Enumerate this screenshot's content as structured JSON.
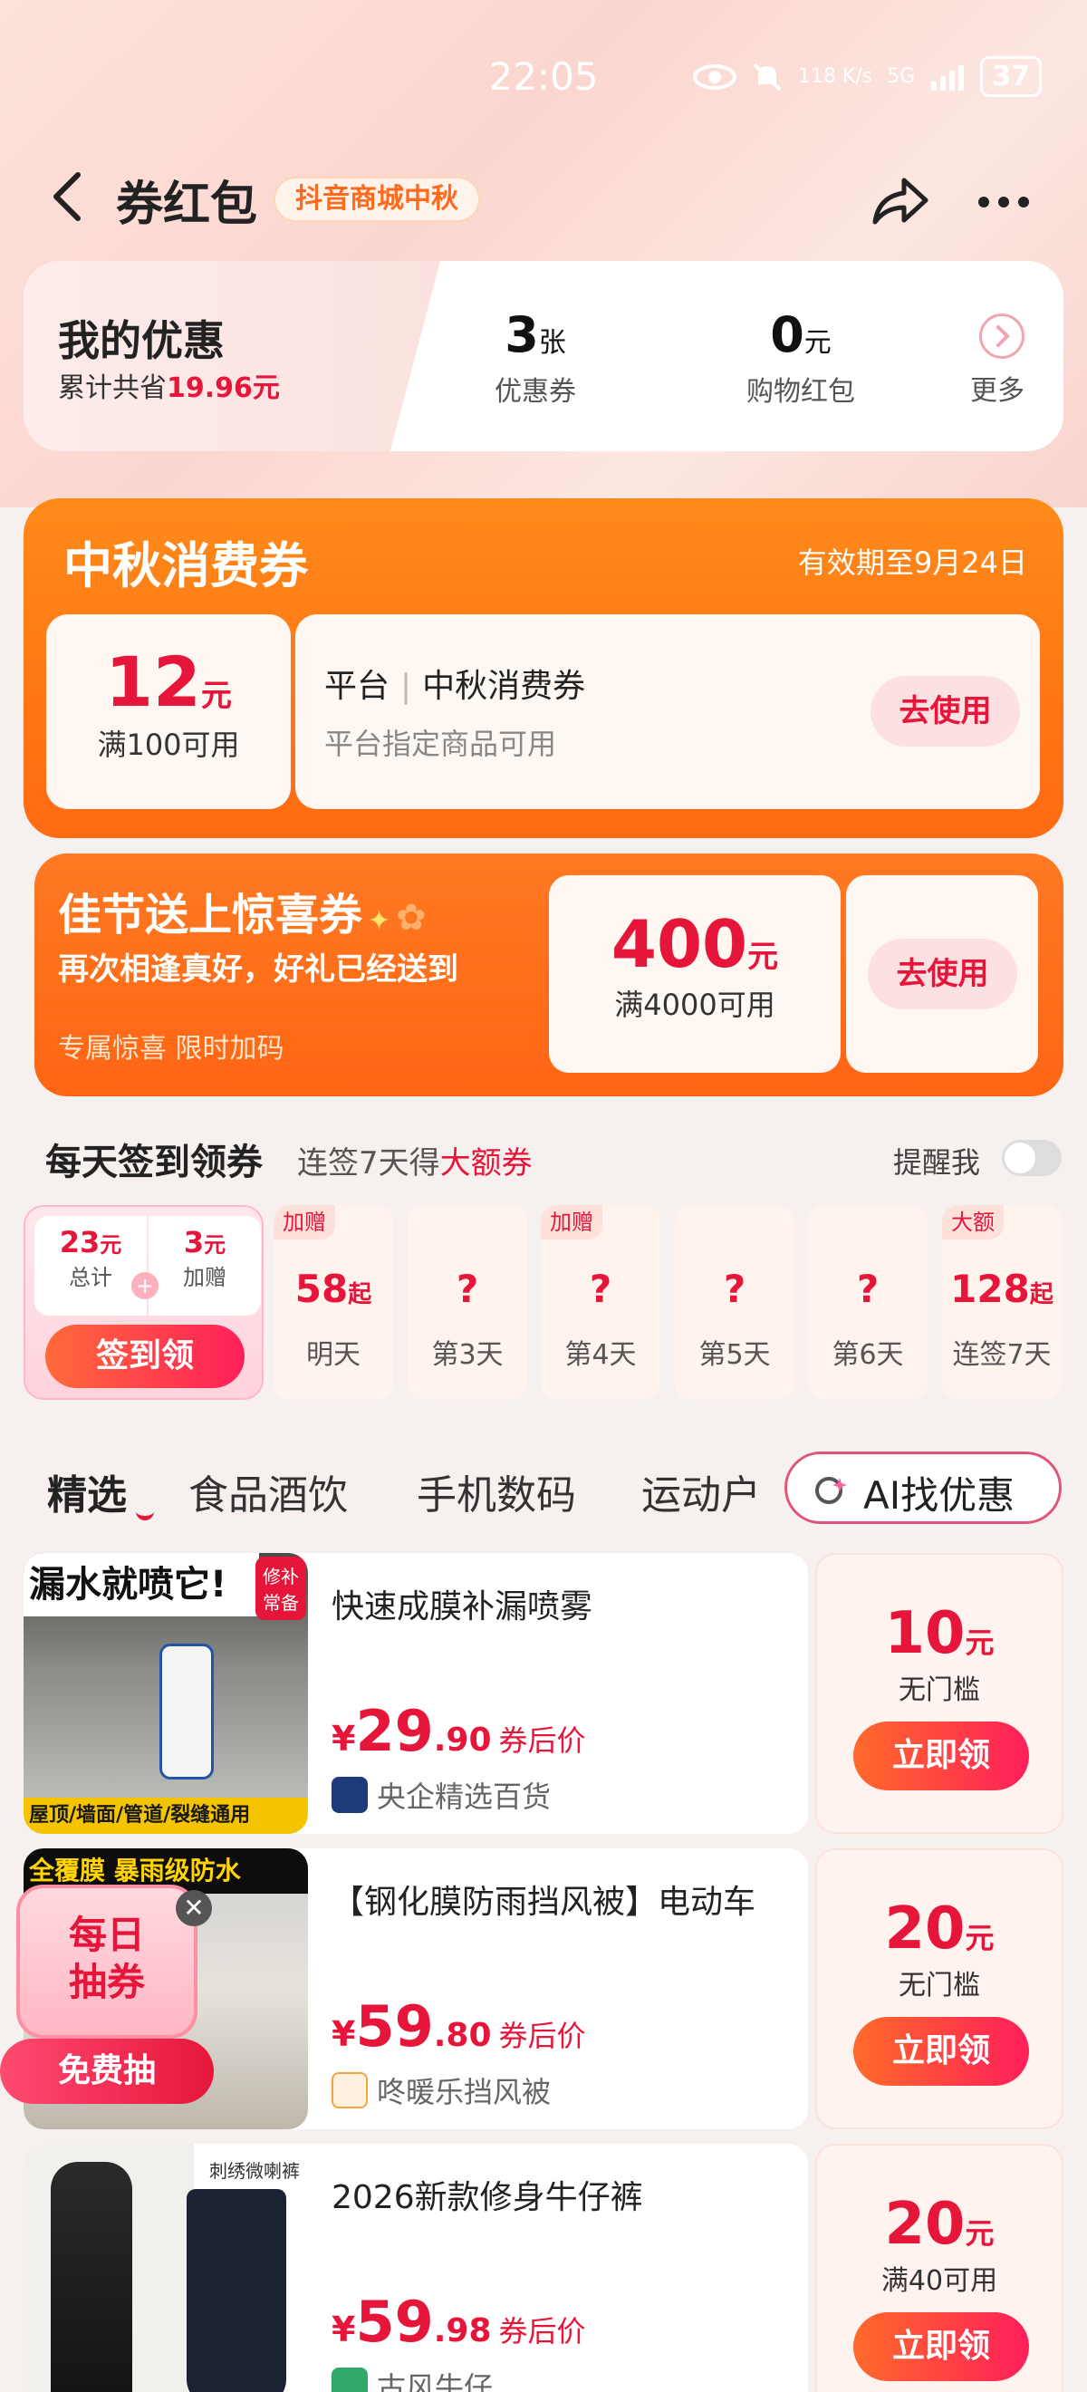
{
  "status_bar": {
    "time": "22:05",
    "network_speed": "118 K/s",
    "network_type": "5G",
    "battery": "37"
  },
  "header": {
    "title": "券红包",
    "event_badge": "抖音商城中秋"
  },
  "my_discount": {
    "title": "我的优惠",
    "saved_prefix": "累计共省",
    "saved_amount": "19.96元",
    "coupons_count": "3",
    "coupons_unit": "张",
    "coupons_label": "优惠券",
    "redpacket_amount": "0",
    "redpacket_unit": "元",
    "redpacket_label": "购物红包",
    "more_label": "更多"
  },
  "mid_autumn": {
    "title": "中秋消费券",
    "validity": "有效期至9月24日",
    "amount": "12",
    "unit": "元",
    "condition": "满100可用",
    "name_a": "平台",
    "name_b": "中秋消费券",
    "desc": "平台指定商品可用",
    "button": "去使用"
  },
  "festival": {
    "title": "佳节送上惊喜券",
    "subtitle": "再次相逢真好，好礼已经送到",
    "note": "专属惊喜 限时加码",
    "amount": "400",
    "unit": "元",
    "condition": "满4000可用",
    "button": "去使用"
  },
  "sign_in": {
    "title": "每天签到领券",
    "subtitle_prefix": "连签7天得",
    "subtitle_highlight": "大额券",
    "remind_label": "提醒我",
    "remind_on": false,
    "total_value": "23",
    "total_label": "总计",
    "bonus_value": "3",
    "bonus_label": "加赠",
    "unit": "元",
    "button": "签到领",
    "days": [
      {
        "tag": "加赠",
        "value": "58",
        "suffix": "起",
        "label": "明天"
      },
      {
        "tag": "",
        "value": "?",
        "suffix": "",
        "label": "第3天"
      },
      {
        "tag": "加赠",
        "value": "?",
        "suffix": "",
        "label": "第4天"
      },
      {
        "tag": "",
        "value": "?",
        "suffix": "",
        "label": "第5天"
      },
      {
        "tag": "",
        "value": "?",
        "suffix": "",
        "label": "第6天"
      },
      {
        "tag": "大额",
        "value": "128",
        "suffix": "起",
        "label": "连签7天"
      }
    ]
  },
  "tabs": {
    "items": [
      "精选",
      "食品酒饮",
      "手机数码",
      "运动户"
    ],
    "active": "精选",
    "ai_button": "AI找优惠"
  },
  "products": [
    {
      "name": "快速成膜补漏喷雾",
      "price_int": "29",
      "price_dec": ".90",
      "price_currency": "¥",
      "price_note": "券后价",
      "store": "央企精选百货",
      "coupon_amount": "10",
      "coupon_unit": "元",
      "coupon_condition": "无门槛",
      "button": "立即领",
      "image_text_top": "漏水就喷它!",
      "image_text_badge": "修补常备",
      "image_text_bottom": "屋顶/墙面/管道/裂缝通用"
    },
    {
      "name": "【钢化膜防雨挡风被】电动车",
      "price_int": "59",
      "price_dec": ".80",
      "price_currency": "¥",
      "price_note": "券后价",
      "store": "咚暖乐挡风被",
      "coupon_amount": "20",
      "coupon_unit": "元",
      "coupon_condition": "无门槛",
      "button": "立即领",
      "image_text_top": "全覆膜 暴雨级防水"
    },
    {
      "name": "2026新款修身牛仔裤",
      "price_int": "59",
      "price_dec": ".98",
      "price_currency": "¥",
      "price_note": "券后价",
      "store": "古风牛仔",
      "coupon_amount": "20",
      "coupon_unit": "元",
      "coupon_condition": "满40可用",
      "button": "立即领",
      "image_text_top": "刺绣微喇裤"
    }
  ],
  "daily_draw": {
    "title_line1": "每日",
    "title_line2": "抽券",
    "button": "免费抽",
    "close": "✕"
  },
  "colors": {
    "accent_red": "#e6163b",
    "orange": "#ff7a1a",
    "page_bg": "#f6f1ee"
  }
}
